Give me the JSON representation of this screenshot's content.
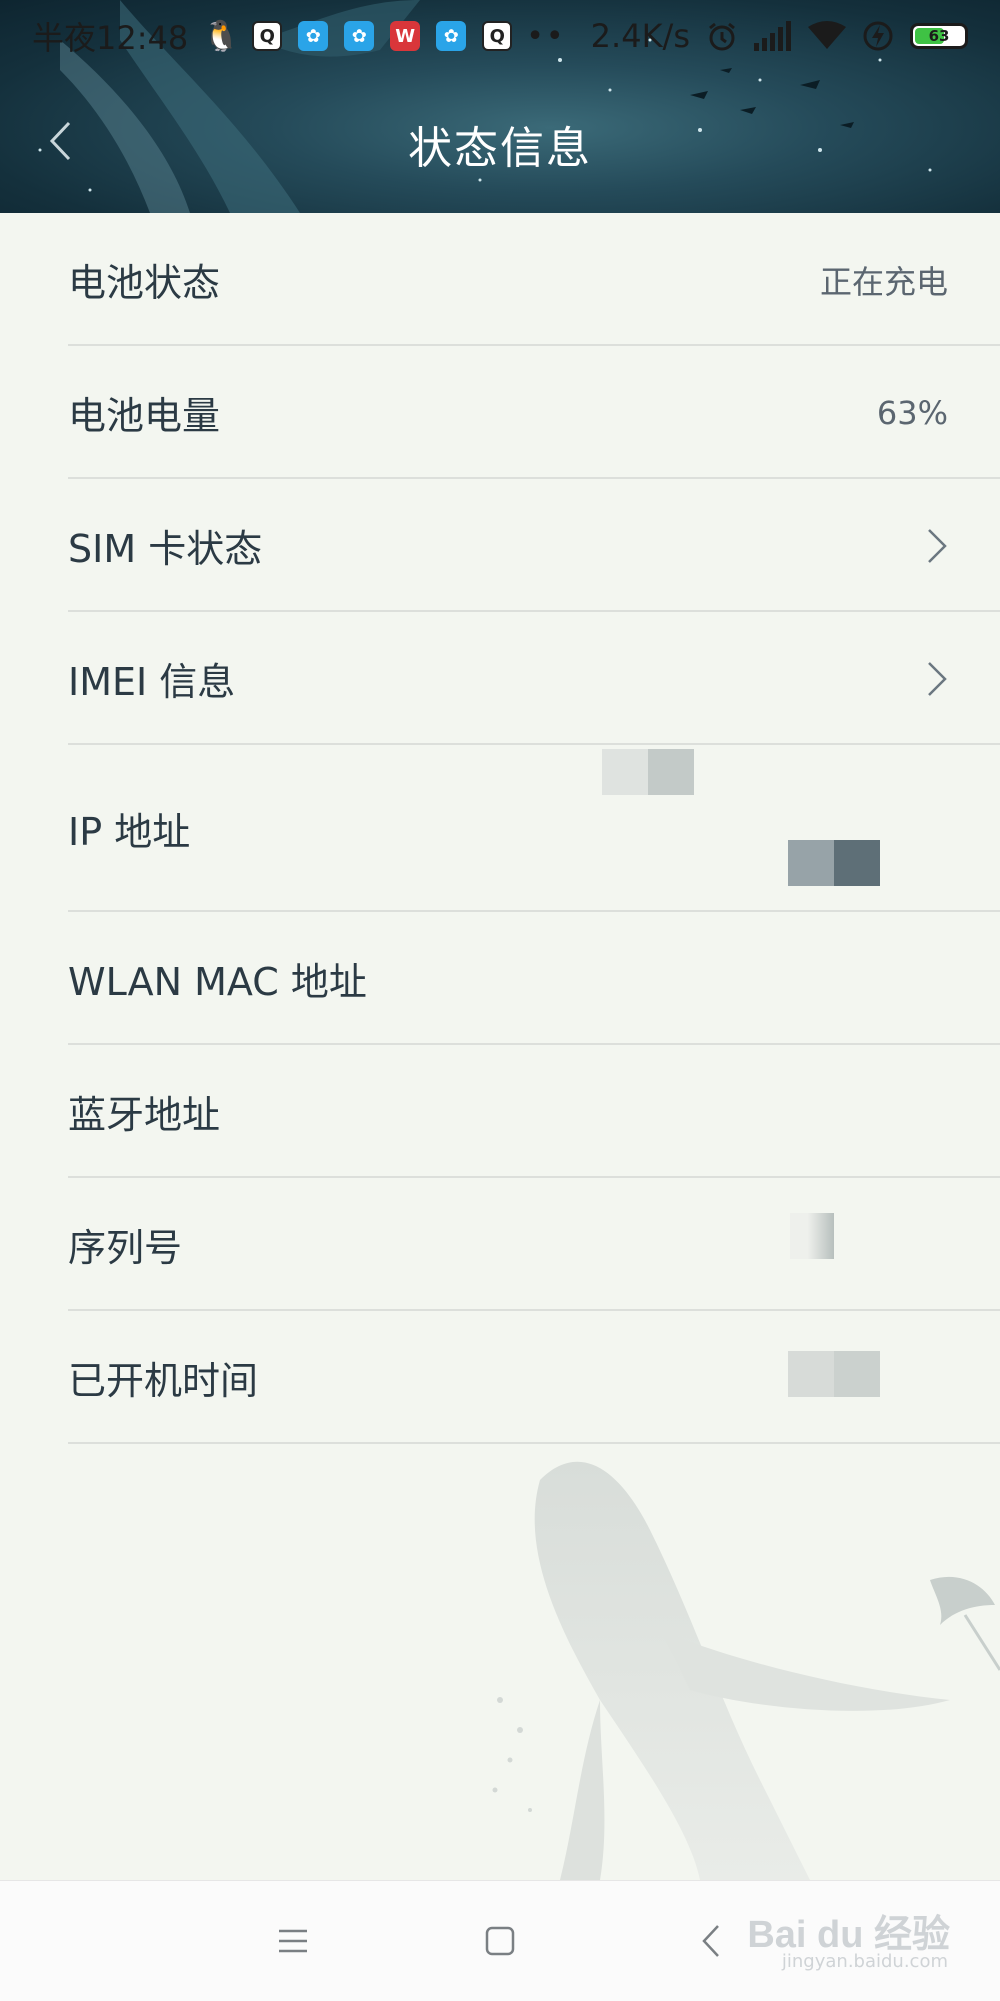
{
  "status_bar": {
    "time": "半夜12:48",
    "net_speed": "2.4K/s",
    "battery_level": "63",
    "battery_fraction": 0.63,
    "notification_icons": [
      "qq-icon",
      "qzone-icon",
      "baidu-icon",
      "baidu-icon",
      "wps-icon",
      "baidu-icon",
      "qzone-icon"
    ],
    "more_indicator": "••",
    "colors": {
      "battery_fill": "#3fc244",
      "qq": "#1ca4ef",
      "baidu": "#2aa4e8",
      "wps": "#d9363a"
    }
  },
  "header": {
    "title": "状态信息",
    "back_icon": "chevron-left-icon"
  },
  "rows": [
    {
      "label": "电池状态",
      "value": "正在充电"
    },
    {
      "label": "电池电量",
      "value": "63%"
    },
    {
      "label": "SIM 卡状态",
      "action_icon": "chevron-right-icon"
    },
    {
      "label": "IMEI 信息",
      "action_icon": "chevron-right-icon"
    },
    {
      "label": "IP 地址"
    },
    {
      "label": "WLAN MAC 地址"
    },
    {
      "label": "蓝牙地址"
    },
    {
      "label": "序列号"
    },
    {
      "label": "已开机时间"
    }
  ],
  "nav_bar": {
    "icons": [
      "menu-icon",
      "home-icon",
      "back-icon"
    ]
  },
  "watermark": {
    "brand": "Bai du 经验",
    "url": "jingyan.baidu.com"
  }
}
